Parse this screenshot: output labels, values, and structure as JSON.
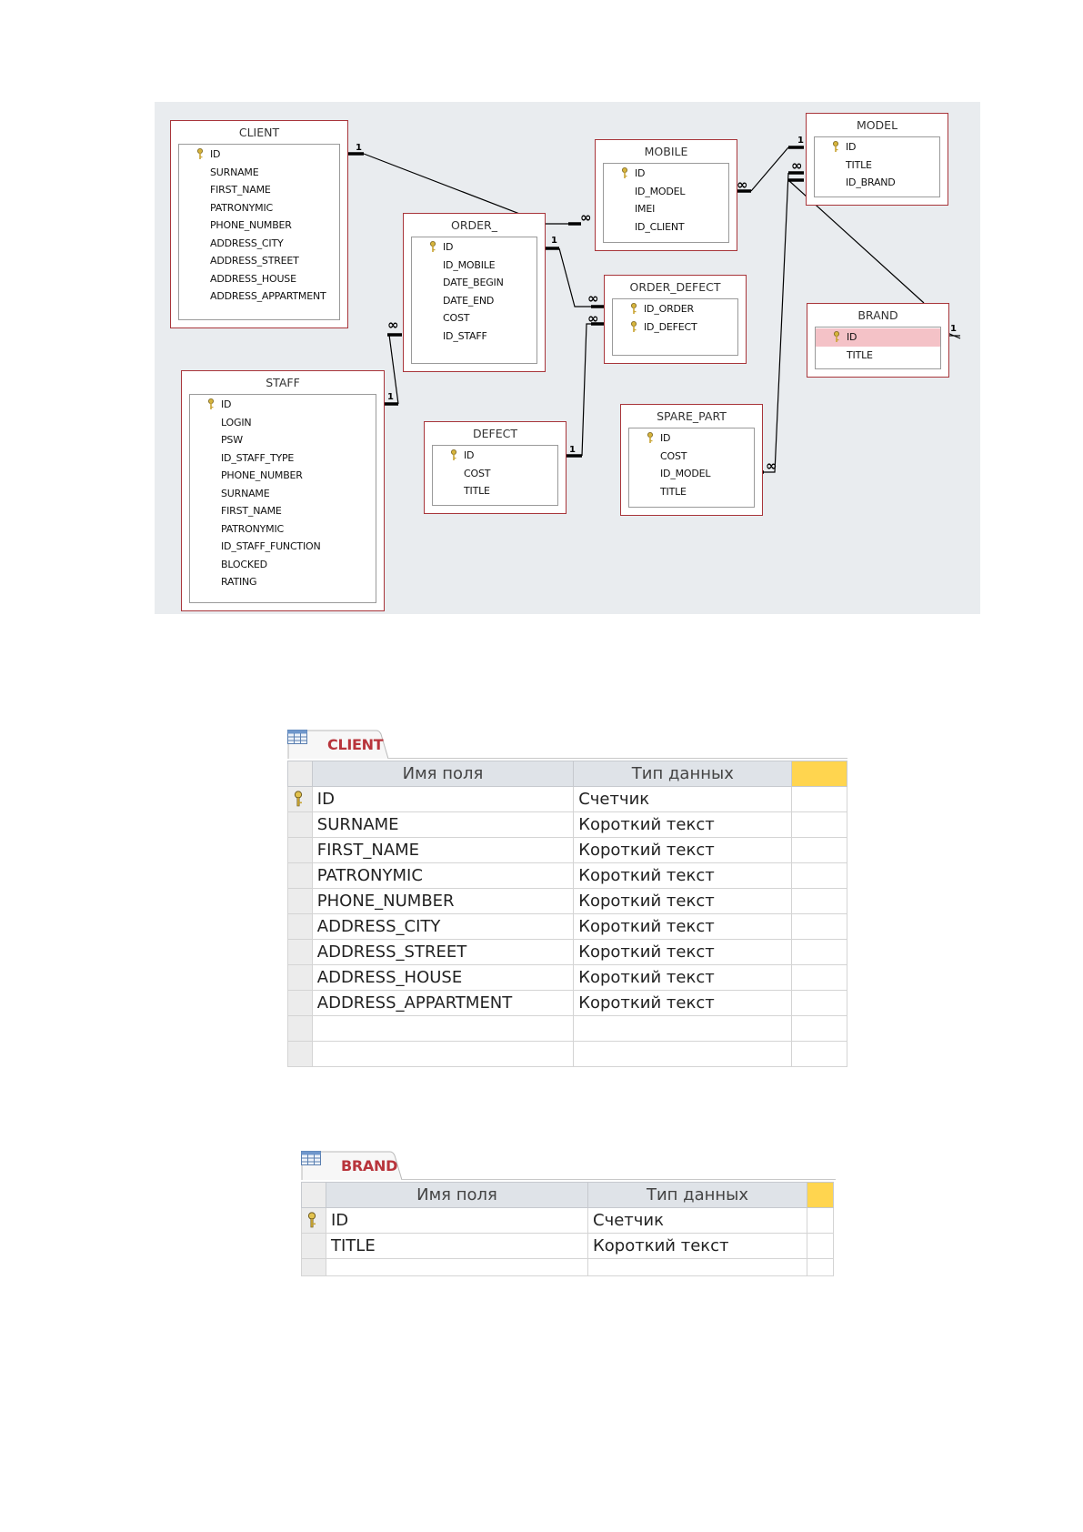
{
  "diagram": {
    "tables": {
      "client": {
        "title": "CLIENT",
        "fields": [
          "ID",
          "SURNAME",
          "FIRST_NAME",
          "PATRONYMIC",
          "PHONE_NUMBER",
          "ADDRESS_CITY",
          "ADDRESS_STREET",
          "ADDRESS_HOUSE",
          "ADDRESS_APPARTMENT"
        ]
      },
      "order": {
        "title": "ORDER_",
        "fields": [
          "ID",
          "ID_MOBILE",
          "DATE_BEGIN",
          "DATE_END",
          "COST",
          "ID_STAFF"
        ]
      },
      "mobile": {
        "title": "MOBILE",
        "fields": [
          "ID",
          "ID_MODEL",
          "IMEI",
          "ID_CLIENT"
        ]
      },
      "model": {
        "title": "MODEL",
        "fields": [
          "ID",
          "TITLE",
          "ID_BRAND"
        ]
      },
      "order_defect": {
        "title": "ORDER_DEFECT",
        "fields": [
          "ID_ORDER",
          "ID_DEFECT"
        ]
      },
      "brand": {
        "title": "BRAND",
        "fields": [
          "ID",
          "TITLE"
        ]
      },
      "staff": {
        "title": "STAFF",
        "fields": [
          "ID",
          "LOGIN",
          "PSW",
          "ID_STAFF_TYPE",
          "PHONE_NUMBER",
          "SURNAME",
          "FIRST_NAME",
          "PATRONYMIC",
          "ID_STAFF_FUNCTION",
          "BLOCKED",
          "RATING"
        ]
      },
      "defect": {
        "title": "DEFECT",
        "fields": [
          "ID",
          "COST",
          "TITLE"
        ]
      },
      "spare_part": {
        "title": "SPARE_PART",
        "fields": [
          "ID",
          "COST",
          "ID_MODEL",
          "TITLE"
        ]
      }
    },
    "cardinality": {
      "one": "1",
      "many": "∞"
    },
    "colors": {
      "table_border": "#a8353a",
      "highlight": "#f4c2c7",
      "background": "#e9ecef"
    }
  },
  "grids": {
    "client": {
      "tab_label": "CLIENT",
      "col_field": "Имя поля",
      "col_type": "Тип данных",
      "rows": [
        {
          "name": "ID",
          "type": "Счетчик",
          "pk": true
        },
        {
          "name": "SURNAME",
          "type": "Короткий текст"
        },
        {
          "name": "FIRST_NAME",
          "type": "Короткий текст"
        },
        {
          "name": "PATRONYMIC",
          "type": "Короткий текст"
        },
        {
          "name": "PHONE_NUMBER",
          "type": "Короткий текст"
        },
        {
          "name": "ADDRESS_CITY",
          "type": "Короткий текст"
        },
        {
          "name": "ADDRESS_STREET",
          "type": "Короткий текст"
        },
        {
          "name": "ADDRESS_HOUSE",
          "type": "Короткий текст"
        },
        {
          "name": "ADDRESS_APPARTMENT",
          "type": "Короткий текст"
        }
      ]
    },
    "brand": {
      "tab_label": "BRAND",
      "col_field": "Имя поля",
      "col_type": "Тип данных",
      "rows": [
        {
          "name": "ID",
          "type": "Счетчик",
          "pk": true
        },
        {
          "name": "TITLE",
          "type": "Короткий текст"
        }
      ]
    }
  }
}
